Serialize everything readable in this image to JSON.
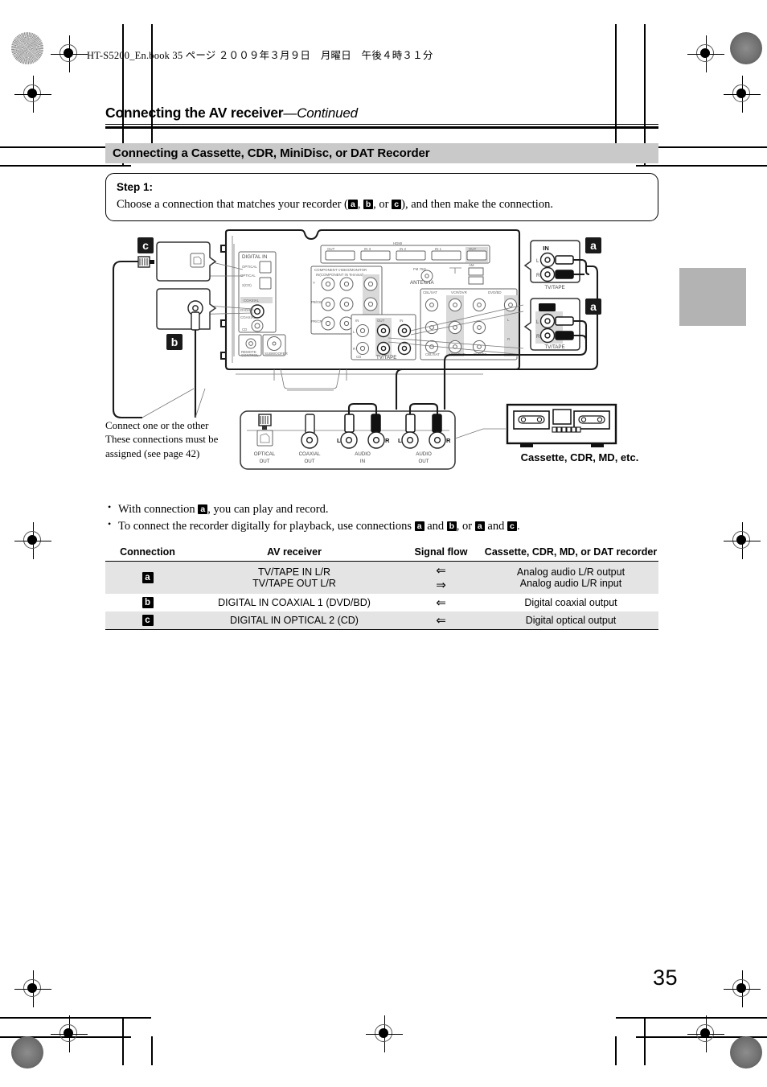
{
  "printmarks": {
    "file_info": "HT-S5200_En.book  35 ページ  ２００９年３月９日　月曜日　午後４時３１分"
  },
  "header": {
    "chapter_title": "Connecting the AV receiver",
    "chapter_title_continued": "—Continued",
    "section_title": "Connecting a Cassette, CDR, MiniDisc, or DAT Recorder"
  },
  "step": {
    "label": "Step 1:",
    "text_part1": "Choose a connection that matches your recorder (",
    "tok_a": "a",
    "sep1": ", ",
    "tok_b": "b",
    "sep2": ", or ",
    "tok_c": "c",
    "text_part2": "), and then make the connection."
  },
  "diagram": {
    "markers": {
      "a1": "a",
      "a2": "a",
      "b": "b",
      "c": "c"
    },
    "optical_box": {
      "title": "OPTICAL",
      "number": "2",
      "source": "(CD)"
    },
    "coaxial_box": {
      "title": "COAXIAL",
      "number": "1",
      "source": "(DVD/BD)"
    },
    "receiver_in": {
      "title": "IN",
      "left": "L",
      "right": "R",
      "label": "TV/TAPE"
    },
    "receiver_out": {
      "title": "OUT",
      "left": "L",
      "right": "R",
      "label": "TV/TAPE"
    },
    "receiver_panel": {
      "digital_in": "DIGITAL IN",
      "optical_label": "OPTICAL",
      "coaxial_group": "COAXIAL",
      "coaxial_label": "COAXIAL",
      "hdmi": "HDMI",
      "component": "COMPONENT VIDEO/MONITOR",
      "antenna": "ANTENNA",
      "fm_am": "FM 75Ω",
      "tvtape": "TV/TAPE",
      "cd": "CD",
      "in_label": "IN",
      "out_label": "OUT",
      "cbl_sat": "CBL/SAT",
      "vcr_dvr": "VCR/DVR",
      "dvd_bd": "DVD/BD",
      "remote_control": "REMOTE CONTROL",
      "subwoofer": "SUBWOOFER"
    },
    "recorder_panel": {
      "optical_out_l1": "OPTICAL",
      "optical_out_l2": "OUT",
      "coaxial_out_l1": "COAXIAL",
      "coaxial_out_l2": "OUT",
      "audio_in_l1": "AUDIO",
      "audio_in_l2": "IN",
      "audio_out_l1": "AUDIO",
      "audio_out_l2": "OUT",
      "left": "L",
      "right": "R"
    },
    "device_caption": "Cassette, CDR, MD, etc.",
    "note_line1": "Connect one or the other",
    "note_line2": "These connections must be",
    "note_line3": "assigned (see page 42)"
  },
  "bullets": {
    "b1_pre": "With connection ",
    "b1_tok": "a",
    "b1_post": ", you can play and record.",
    "b2_pre": "To connect the recorder digitally for playback, use connections ",
    "b2_tok1": "a",
    "b2_mid1": " and ",
    "b2_tok2": "b",
    "b2_mid2": ", or ",
    "b2_tok3": "a",
    "b2_mid3": " and ",
    "b2_tok4": "c",
    "b2_post": "."
  },
  "table": {
    "headers": [
      "Connection",
      "AV receiver",
      "Signal flow",
      "Cassette, CDR, MD, or DAT recorder"
    ],
    "rows": [
      {
        "connection": "a",
        "receiver_line1": "TV/TAPE IN L/R",
        "receiver_line2": "TV/TAPE OUT L/R",
        "flow_line1": "⇐",
        "flow_line2": "⇒",
        "recorder_line1": "Analog audio L/R output",
        "recorder_line2": "Analog audio L/R input"
      },
      {
        "connection": "b",
        "receiver_line1": "DIGITAL IN COAXIAL 1 (DVD/BD)",
        "flow_line1": "⇐",
        "recorder_line1": "Digital coaxial output"
      },
      {
        "connection": "c",
        "receiver_line1": "DIGITAL IN OPTICAL 2 (CD)",
        "flow_line1": "⇐",
        "recorder_line1": "Digital optical output"
      }
    ]
  },
  "footer": {
    "page_number": "35"
  }
}
